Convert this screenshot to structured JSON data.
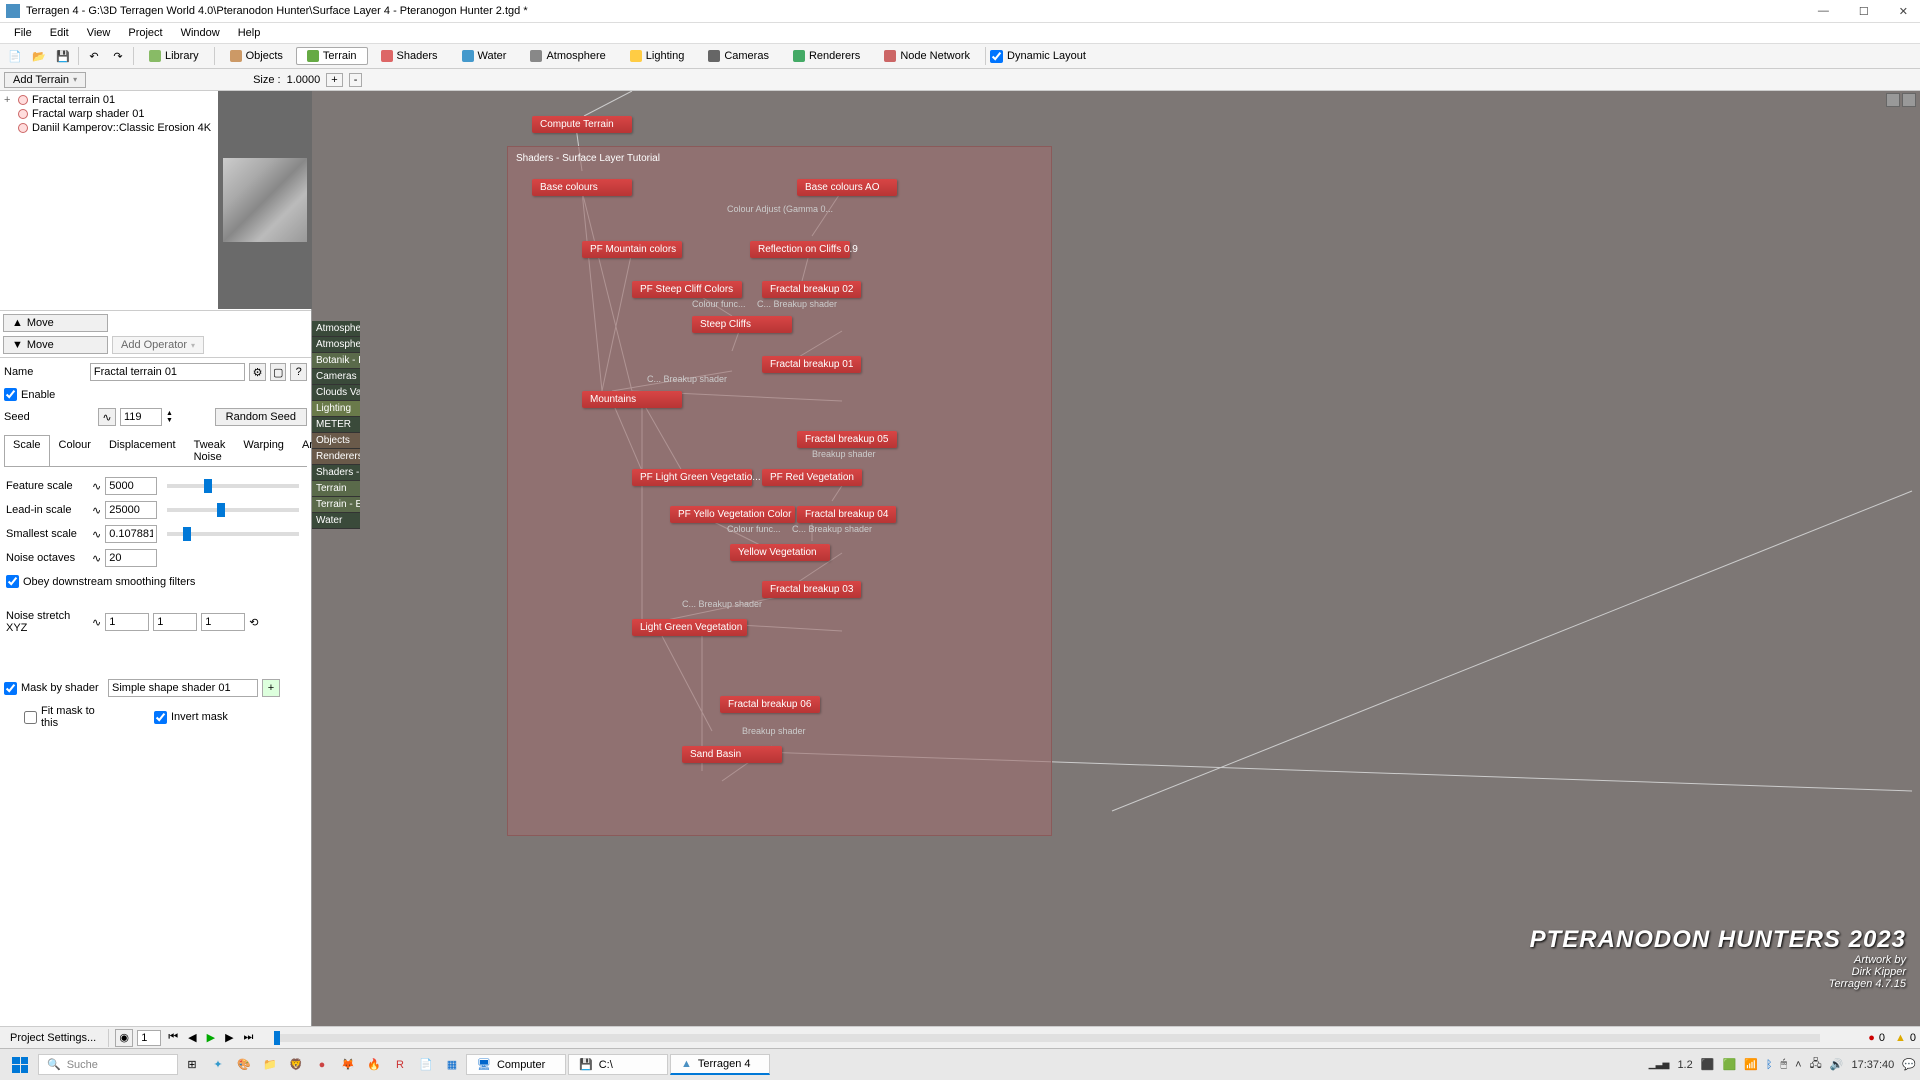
{
  "window": {
    "title": "Terragen 4 - G:\\3D Terragen World 4.0\\Pteranodon Hunter\\Surface Layer 4 - Pteranogon Hunter 2.tgd *",
    "min": "—",
    "max": "☐",
    "close": "✕"
  },
  "menu": {
    "items": [
      "File",
      "Edit",
      "View",
      "Project",
      "Window",
      "Help"
    ]
  },
  "toolbar": {
    "library": "Library",
    "tabs": [
      "Objects",
      "Terrain",
      "Shaders",
      "Water",
      "Atmosphere",
      "Lighting",
      "Cameras",
      "Renderers",
      "Node Network"
    ],
    "active_tab": 1,
    "dynamic_layout": "Dynamic Layout"
  },
  "subtoolbar": {
    "add_terrain": "Add Terrain",
    "size_label": "Size :",
    "size_value": "1.0000"
  },
  "tree": {
    "items": [
      {
        "exp": "+",
        "label": "Fractal terrain 01"
      },
      {
        "exp": "",
        "label": "Fractal warp shader 01"
      },
      {
        "exp": "",
        "label": "Daniil Kamperov::Classic Erosion 4K"
      }
    ]
  },
  "movebar": {
    "move_up": "Move",
    "move_down": "Move",
    "add_operator": "Add Operator"
  },
  "props": {
    "name_label": "Name",
    "name_value": "Fractal terrain 01",
    "enable": "Enable",
    "seed_label": "Seed",
    "seed_value": "119",
    "random_seed": "Random Seed",
    "tabs": [
      "Scale",
      "Colour",
      "Displacement",
      "Tweak Noise",
      "Warping",
      "Animation"
    ],
    "active_tab": 0,
    "feature_scale_label": "Feature scale",
    "feature_scale_value": "5000",
    "leadin_label": "Lead-in scale",
    "leadin_value": "25000",
    "smallest_label": "Smallest scale",
    "smallest_value": "0.107881",
    "octaves_label": "Noise octaves",
    "octaves_value": "20",
    "obey": "Obey downstream smoothing filters",
    "stretch_label": "Noise stretch XYZ",
    "stretch_x": "1",
    "stretch_y": "1",
    "stretch_z": "1",
    "mask_label": "Mask by shader",
    "mask_value": "Simple shape shader 01",
    "fit_mask": "Fit mask to this",
    "invert_mask": "Invert mask"
  },
  "sidelist": {
    "items": [
      "Atmosphere",
      "Atmospher...",
      "Botanik - B...",
      "Cameras",
      "Clouds Vall...",
      "Lighting",
      "METER",
      "Objects",
      "Renderers",
      "Shaders - ...",
      "Terrain",
      "Terrain - Er...",
      "Water"
    ]
  },
  "nodes": {
    "compute_terrain": "Compute Terrain",
    "group_title": "Shaders  - Surface Layer Tutorial",
    "base_colours": "Base colours",
    "base_colours_ao": "Base colours AO",
    "colour_adjust": "Colour Adjust (Gamma 0...",
    "pf_mountain": "PF Mountain colors",
    "reflection": "Reflection on Cliffs 0.9",
    "pf_steep": "PF Steep Cliff Colors",
    "fractal_02": "Fractal breakup 02",
    "colour_func1": "Colour func...",
    "breakup_shader1": "C... Breakup shader",
    "steep_cliffs": "Steep Cliffs",
    "fractal_01": "Fractal breakup 01",
    "breakup_shader2": "C... Breakup shader",
    "mountains": "Mountains",
    "fractal_05": "Fractal breakup 05",
    "breakup_shader3": "Breakup shader",
    "pf_light_green": "PF Light Green Vegetatio...",
    "pf_red": "PF Red Vegetation",
    "pf_yello": "PF Yello Vegetation Color",
    "fractal_04": "Fractal breakup 04",
    "colour_func2": "Colour func...",
    "breakup_shader4": "C... Breakup shader",
    "yellow_veg": "Yellow Vegetation",
    "fractal_03": "Fractal breakup 03",
    "breakup_shader5": "C...   Breakup shader",
    "light_green_veg": "Light Green Vegetation",
    "fractal_06": "Fractal breakup 06",
    "breakup_shader6": "Breakup shader",
    "sand_basin": "Sand Basin"
  },
  "bottombar": {
    "project_settings": "Project Settings...",
    "frame": "1"
  },
  "statusbar": {
    "red": "0",
    "yellow": "0"
  },
  "taskbar": {
    "search": "Suche",
    "computer": "Computer",
    "c_drive": "C:\\",
    "terragen": "Terragen 4",
    "time": "17:37:40",
    "version": "1.2"
  },
  "watermark": {
    "title": "PTERANODON HUNTERS 2023",
    "artwork": "Artwork by",
    "author": "Dirk Kipper",
    "version": "Terragen 4.7.15"
  }
}
